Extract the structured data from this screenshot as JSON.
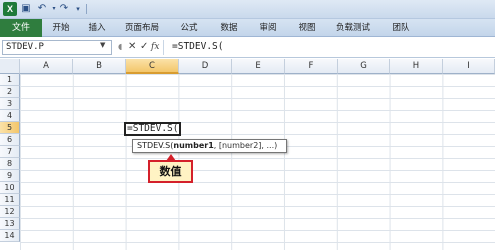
{
  "ribbon": {
    "file_tab": "文件",
    "tabs": [
      "开始",
      "插入",
      "页面布局",
      "公式",
      "数据",
      "审阅",
      "视图",
      "负载测试",
      "团队"
    ]
  },
  "formula_bar": {
    "name_box": "STDEV.P",
    "cancel": "✕",
    "enter": "✓",
    "fx": "fx",
    "formula": "=STDEV.S("
  },
  "sheet": {
    "columns": [
      "A",
      "B",
      "C",
      "D",
      "E",
      "F",
      "G",
      "H",
      "I"
    ],
    "rows": [
      "1",
      "2",
      "3",
      "4",
      "5",
      "6",
      "7",
      "8",
      "9",
      "10",
      "11",
      "12",
      "13",
      "14"
    ],
    "selected_column": "C",
    "selected_row": "5",
    "active_cell_text": "=STDEV.S("
  },
  "tooltip": {
    "fn": "STDEV.S(",
    "arg1": "number1",
    "rest": ", [number2], ...)"
  },
  "callout": {
    "text": "数值"
  },
  "colors": {
    "file_tab": "#2f7d3e",
    "callout_border": "#d4202a",
    "callout_fill": "#fff3c4",
    "selected_header": "#f3c66b"
  }
}
